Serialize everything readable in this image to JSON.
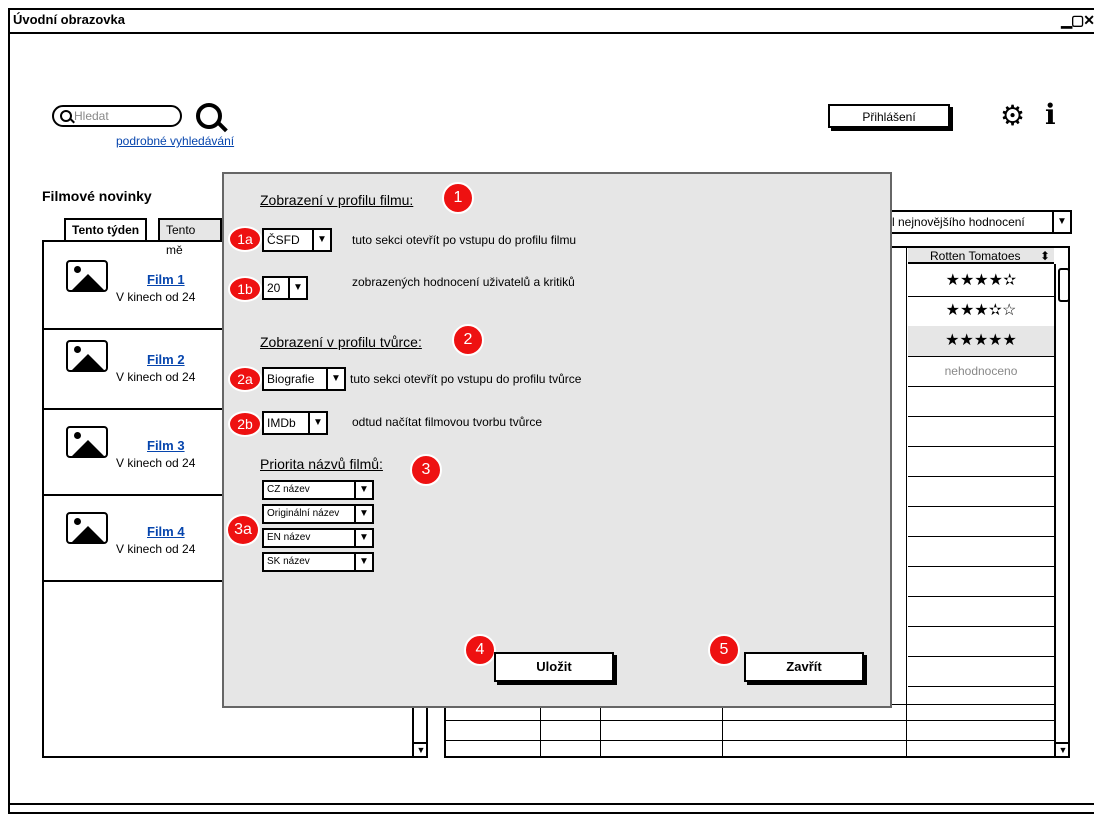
{
  "window": {
    "title": "Úvodní obrazovka",
    "controls": "_ □ ×"
  },
  "search": {
    "placeholder": "Hledat",
    "advanced_link": "podrobné vyhledávání"
  },
  "header": {
    "login_label": "Přihlášení",
    "gear_icon": "gear-icon",
    "info_icon": "info-icon"
  },
  "news": {
    "title": "Filmové novinky",
    "tabs": [
      {
        "label": "Tento týden"
      },
      {
        "label": "Tento mě"
      }
    ],
    "films": [
      {
        "name": "Film 1",
        "date": "V kinech od 24"
      },
      {
        "name": "Film 2",
        "date": "V kinech od 24"
      },
      {
        "name": "Film 3",
        "date": "V kinech od 24"
      },
      {
        "name": "Film 4",
        "date": "V kinech od 24"
      }
    ]
  },
  "table": {
    "sort_value": "l nejnovějšího hodnocení",
    "rt_header": "Rotten Tomatoes",
    "rt_rows": [
      "★★★★✫",
      "★★★✫☆",
      "★★★★★",
      "nehodnoceno"
    ]
  },
  "modal": {
    "s1": {
      "badge": "1",
      "heading": "Zobrazení v profilu filmu:"
    },
    "s1a": {
      "badge": "1a",
      "value": "ČSFD",
      "desc": "tuto sekci otevřít po vstupu do profilu filmu"
    },
    "s1b": {
      "badge": "1b",
      "value": "20",
      "desc": "zobrazených hodnocení uživatelů a kritiků"
    },
    "s2": {
      "badge": "2",
      "heading": "Zobrazení v profilu tvůrce:"
    },
    "s2a": {
      "badge": "2a",
      "value": "Biografie",
      "desc": "tuto sekci otevřít po vstupu do profilu tvůrce"
    },
    "s2b": {
      "badge": "2b",
      "value": "IMDb",
      "desc": "odtud načítat filmovou tvorbu tvůrce"
    },
    "s3": {
      "badge": "3",
      "heading": "Priorita názvů filmů:"
    },
    "s3a": {
      "badge": "3a",
      "options": [
        "CZ název",
        "Originální název",
        "EN název",
        "SK název"
      ]
    },
    "save": {
      "badge": "4",
      "label": "Uložit"
    },
    "close": {
      "badge": "5",
      "label": "Zavřít"
    }
  }
}
